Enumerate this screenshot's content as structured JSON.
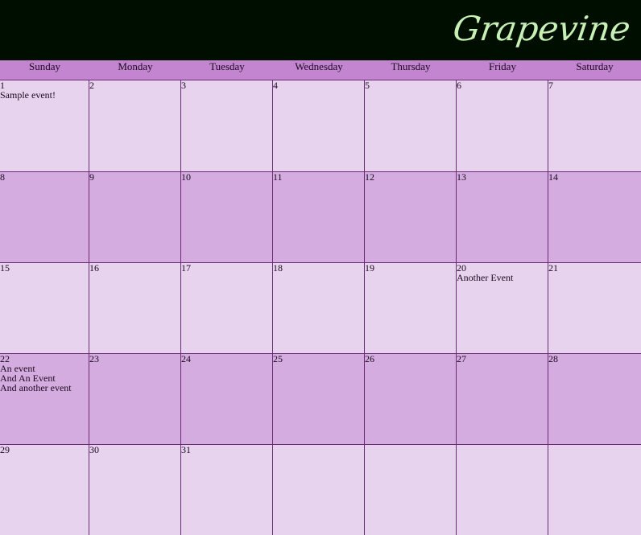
{
  "app": {
    "logo_text": "Grapevine"
  },
  "days_of_week": [
    "Sunday",
    "Monday",
    "Tuesday",
    "Wednesday",
    "Thursday",
    "Friday",
    "Saturday"
  ],
  "weeks": [
    {
      "days": [
        {
          "num": "1",
          "events": [
            "Sample event!"
          ]
        },
        {
          "num": "2",
          "events": []
        },
        {
          "num": "3",
          "events": []
        },
        {
          "num": "4",
          "events": []
        },
        {
          "num": "5",
          "events": []
        },
        {
          "num": "6",
          "events": []
        },
        {
          "num": "7",
          "events": []
        }
      ]
    },
    {
      "days": [
        {
          "num": "8",
          "events": []
        },
        {
          "num": "9",
          "events": []
        },
        {
          "num": "10",
          "events": []
        },
        {
          "num": "11",
          "events": []
        },
        {
          "num": "12",
          "events": []
        },
        {
          "num": "13",
          "events": []
        },
        {
          "num": "14",
          "events": []
        }
      ]
    },
    {
      "days": [
        {
          "num": "15",
          "events": []
        },
        {
          "num": "16",
          "events": []
        },
        {
          "num": "17",
          "events": []
        },
        {
          "num": "18",
          "events": []
        },
        {
          "num": "19",
          "events": []
        },
        {
          "num": "20",
          "events": [
            "Another Event"
          ]
        },
        {
          "num": "21",
          "events": []
        }
      ]
    },
    {
      "days": [
        {
          "num": "22",
          "events": [
            "An event",
            "And An Event",
            "And another event"
          ]
        },
        {
          "num": "23",
          "events": []
        },
        {
          "num": "24",
          "events": []
        },
        {
          "num": "25",
          "events": []
        },
        {
          "num": "26",
          "events": []
        },
        {
          "num": "27",
          "events": []
        },
        {
          "num": "28",
          "events": []
        }
      ]
    },
    {
      "days": [
        {
          "num": "29",
          "events": []
        },
        {
          "num": "30",
          "events": []
        },
        {
          "num": "31",
          "events": []
        },
        {
          "num": "",
          "events": []
        },
        {
          "num": "",
          "events": []
        },
        {
          "num": "",
          "events": []
        },
        {
          "num": "",
          "events": []
        }
      ]
    }
  ],
  "colors": {
    "header_bg": "#000e00",
    "logo": "#c6f0b5",
    "dayhead_bg": "#c384d0",
    "row_light": "#e8d3ee",
    "row_dark": "#d4acdf",
    "grid_line": "#6a2a74"
  }
}
